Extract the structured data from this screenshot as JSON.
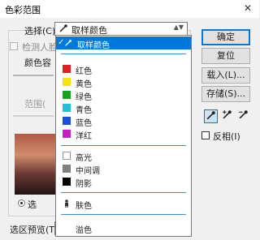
{
  "window": {
    "title": "色彩范围",
    "close_glyph": "✕"
  },
  "select": {
    "label": "选择(C):",
    "value": "取样颜色",
    "arrow": "▲▼"
  },
  "left_panel": {
    "detect_faces_label": "检测人脸",
    "fuzziness_label": "颜色容",
    "range_label": "范围(",
    "radio_label": "选",
    "preview_label": "选区预览(T):"
  },
  "buttons": {
    "ok": "确定",
    "reset": "复位",
    "load": "载入(L)...",
    "save": "存储(S)..."
  },
  "invert_label": "反相(I)",
  "dropdown": {
    "items": [
      {
        "label": "取样颜色",
        "selected": true,
        "color": ""
      },
      {
        "label": "红色",
        "color": "#e31e1e"
      },
      {
        "label": "黄色",
        "color": "#f5e400"
      },
      {
        "label": "绿色",
        "color": "#1aa31a"
      },
      {
        "label": "青色",
        "color": "#1cc4d8"
      },
      {
        "label": "蓝色",
        "color": "#1a4fd8"
      },
      {
        "label": "洋红",
        "color": "#c81ec8"
      },
      {
        "label": "高光",
        "color": "#ffffff"
      },
      {
        "label": "中间调",
        "color": "#7f7f7f"
      },
      {
        "label": "阴影",
        "color": "#000000"
      },
      {
        "label": "肤色",
        "color": ""
      },
      {
        "label": "溢色",
        "color": ""
      }
    ]
  },
  "colors": {
    "accent": "#0078d7"
  }
}
